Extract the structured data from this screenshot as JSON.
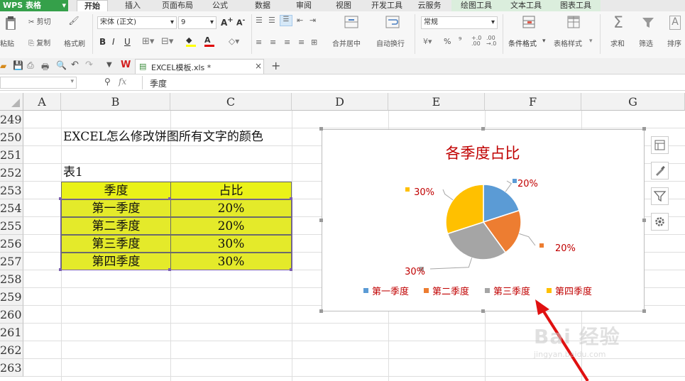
{
  "menu": {
    "app_label": "WPS 表格",
    "tabs": [
      "开始",
      "插入",
      "页面布局",
      "公式",
      "数据",
      "审阅",
      "视图",
      "开发工具",
      "云服务",
      "绘图工具",
      "文本工具",
      "图表工具"
    ],
    "active_tab": "开始"
  },
  "ribbon": {
    "paste": "粘贴",
    "cut": "剪切",
    "copy": "复制",
    "format_painter": "格式刷",
    "font_name": "宋体 (正文)",
    "font_size": "9",
    "merge_center": "合并居中",
    "auto_wrap": "自动换行",
    "number_format": "常规",
    "percent": "%",
    "thousands": "⁹",
    "conditional_format": "条件格式",
    "table_style": "表格样式",
    "sum": "求和",
    "filter": "筛选",
    "sort": "排序"
  },
  "doc_tab": {
    "name": "EXCEL模板.xls *"
  },
  "formula_bar": {
    "fx": "fx",
    "content": "季度"
  },
  "columns": [
    "A",
    "B",
    "C",
    "D",
    "E",
    "F",
    "G"
  ],
  "rows": [
    "249",
    "250",
    "251",
    "252",
    "253",
    "254",
    "255",
    "256",
    "257",
    "258",
    "259",
    "260",
    "261",
    "262",
    "263"
  ],
  "sheet": {
    "title": "EXCEL怎么修改饼图所有文字的颜色",
    "table_label": "表1",
    "table": {
      "headers": [
        "季度",
        "占比"
      ],
      "rows": [
        [
          "第一季度",
          "20%"
        ],
        [
          "第二季度",
          "20%"
        ],
        [
          "第三季度",
          "30%"
        ],
        [
          "第四季度",
          "30%"
        ]
      ]
    }
  },
  "chart_data": {
    "type": "pie",
    "title": "各季度占比",
    "categories": [
      "第一季度",
      "第二季度",
      "第三季度",
      "第四季度"
    ],
    "values": [
      20,
      20,
      30,
      30
    ],
    "data_labels": [
      "20%",
      "20%",
      "30%",
      "30%"
    ],
    "colors": [
      "#5b9bd5",
      "#ed7d31",
      "#a5a5a5",
      "#ffc000"
    ],
    "text_color": "#c00000",
    "legend_position": "bottom"
  },
  "watermark": {
    "text": "Bai 经验",
    "url": "jingyan.baidu.com"
  }
}
